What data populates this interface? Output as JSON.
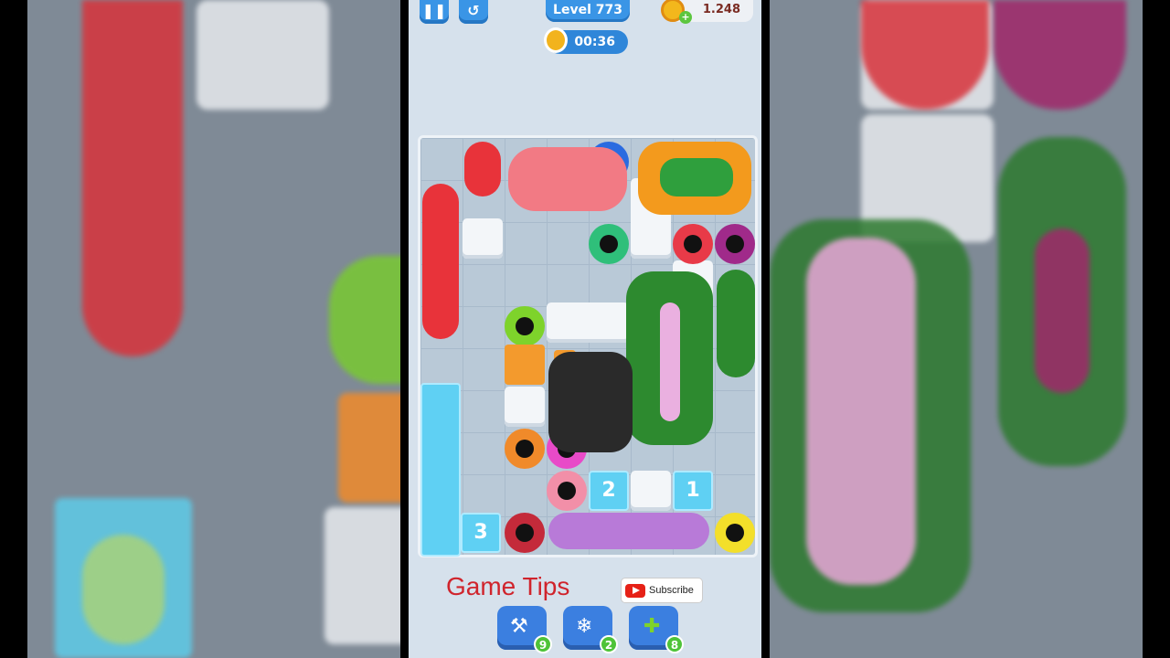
{
  "header": {
    "pause_icon": "pause-icon",
    "restart_icon": "restart-icon",
    "level": "Level 773",
    "timer": "00:36",
    "coins": "1.248"
  },
  "board": {
    "ice_labels": [
      "3",
      "2",
      "1"
    ],
    "snake_colors": [
      "#e8333a",
      "#f27a84",
      "#f39a1d",
      "#2f9f3d",
      "#2a2a2a",
      "#9b6bd8",
      "#2d8a2f"
    ],
    "hole_colors": [
      "#2a6be0",
      "#2fbf7a",
      "#e83a48",
      "#a02a8a",
      "#7ed32b",
      "#f08a2a",
      "#e84ac8",
      "#f28fa8",
      "#c42a3a",
      "#f3df2a"
    ]
  },
  "overlay": {
    "tips_label": "Game Tips",
    "subscribe_label": "Subscribe"
  },
  "boosters": [
    {
      "icon": "hammer-icon",
      "count": "9"
    },
    {
      "icon": "freeze-clock-icon",
      "count": "2"
    },
    {
      "icon": "snake-magnet-icon",
      "count": "8"
    }
  ]
}
